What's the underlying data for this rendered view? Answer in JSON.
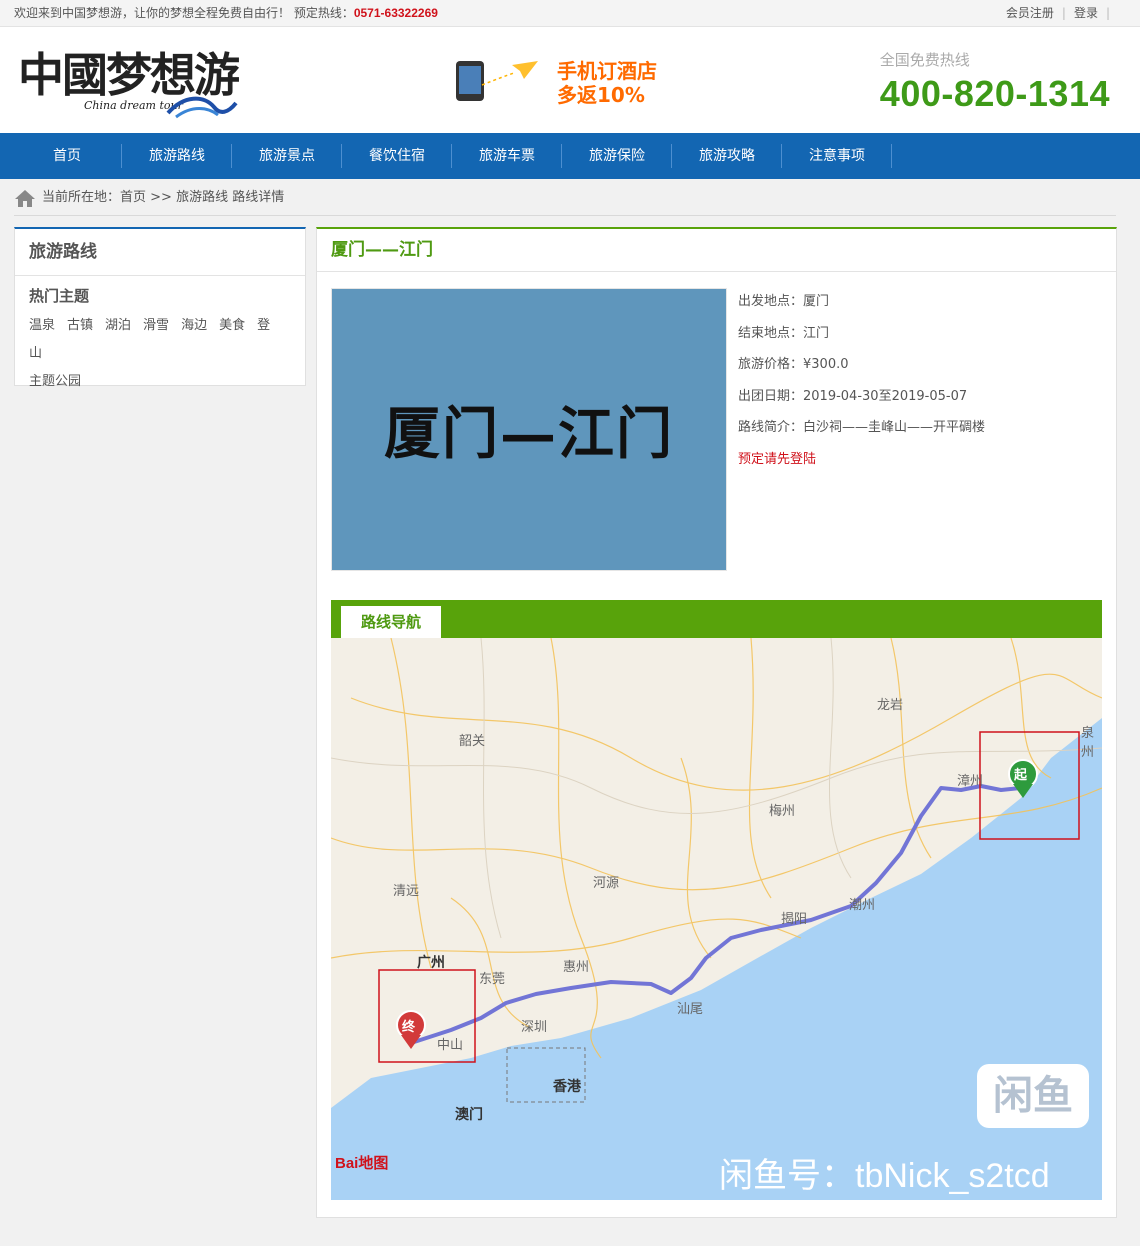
{
  "topbar": {
    "welcome": "欢迎来到中国梦想游，让你的梦想全程免费自由行！ 预定热线：",
    "hotline": "0571-63322269",
    "register": "会员注册",
    "login": "登录"
  },
  "header": {
    "logo_cn": "中國梦想游",
    "logo_en": "China dream tour",
    "promo_line1": "手机订酒店",
    "promo_line2": "多返10%",
    "hotline_label": "全国免费热线",
    "hotline_number": "400-820-1314"
  },
  "nav": {
    "items": [
      "首页",
      "旅游路线",
      "旅游景点",
      "餐饮住宿",
      "旅游车票",
      "旅游保险",
      "旅游攻略",
      "注意事项"
    ]
  },
  "breadcrumb": {
    "prefix": "当前所在地：",
    "path": "首页 >> 旅游路线 路线详情"
  },
  "sidebar": {
    "title": "旅游路线",
    "subtitle": "热门主题",
    "tags": [
      "温泉",
      "古镇",
      "湖泊",
      "滑雪",
      "海边",
      "美食",
      "登山",
      "主题公园"
    ]
  },
  "main": {
    "title": "厦门——江门",
    "cover_text": "厦门—江门",
    "details": [
      {
        "label": "出发地点：",
        "value": "厦门"
      },
      {
        "label": "结束地点：",
        "value": "江门"
      },
      {
        "label": "旅游价格：",
        "value": "¥300.0"
      },
      {
        "label": "出团日期：",
        "value": "2019-04-30至2019-05-07"
      },
      {
        "label": "路线简介：",
        "value": "白沙祠——圭峰山——开平碉楼"
      }
    ],
    "login_prompt": "预定请先登陆",
    "nav_tab": "路线导航"
  },
  "map": {
    "cities": [
      "龙岩",
      "泉州",
      "韶关",
      "漳州",
      "梅州",
      "河源",
      "清远",
      "潮州",
      "揭阳",
      "广州",
      "东莞",
      "惠州",
      "汕尾",
      "深圳",
      "中山",
      "香港",
      "澳门"
    ],
    "start_marker": "起",
    "end_marker": "终",
    "provider": "Bai地图",
    "watermark": "闲鱼号：tbNick_s2tcd",
    "badge": "闲鱼"
  },
  "colors": {
    "nav_blue": "#1366b2",
    "green": "#58a30b",
    "hotline_green": "#3e9a18",
    "red": "#d0121b"
  }
}
